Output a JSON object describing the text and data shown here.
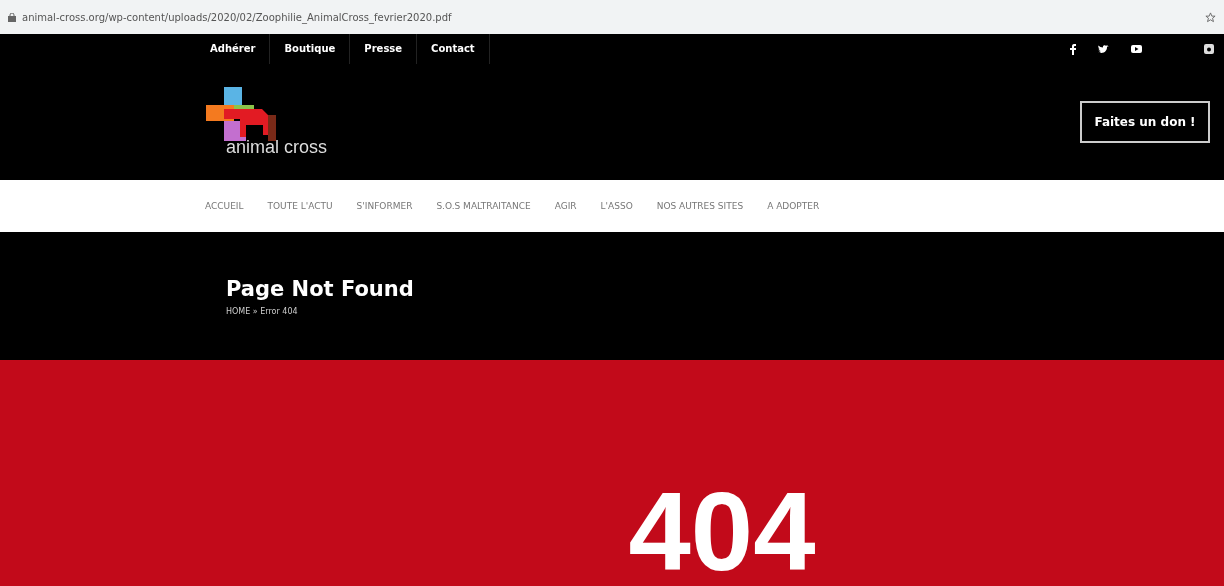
{
  "address_bar": {
    "url": "animal-cross.org/wp-content/uploads/2020/02/Zoophilie_AnimalCross_fevrier2020.pdf"
  },
  "top_links": [
    "Adhérer",
    "Boutique",
    "Presse",
    "Contact"
  ],
  "logo": {
    "text": "animal cross"
  },
  "donate_button": "Faites un don !",
  "main_nav": [
    {
      "label": "ACCUEIL"
    },
    {
      "label": "TOUTE L'ACTU"
    },
    {
      "label": "S'INFORMER"
    },
    {
      "label": "S.O.S MALTRAITANCE"
    },
    {
      "label": "AGIR"
    },
    {
      "label": "L'ASSO"
    },
    {
      "label": "NOS AUTRES SITES"
    },
    {
      "label": "A ADOPTER"
    }
  ],
  "hero": {
    "title": "Page Not Found",
    "breadcrumb": "HOME » Error 404"
  },
  "error_code": "404"
}
